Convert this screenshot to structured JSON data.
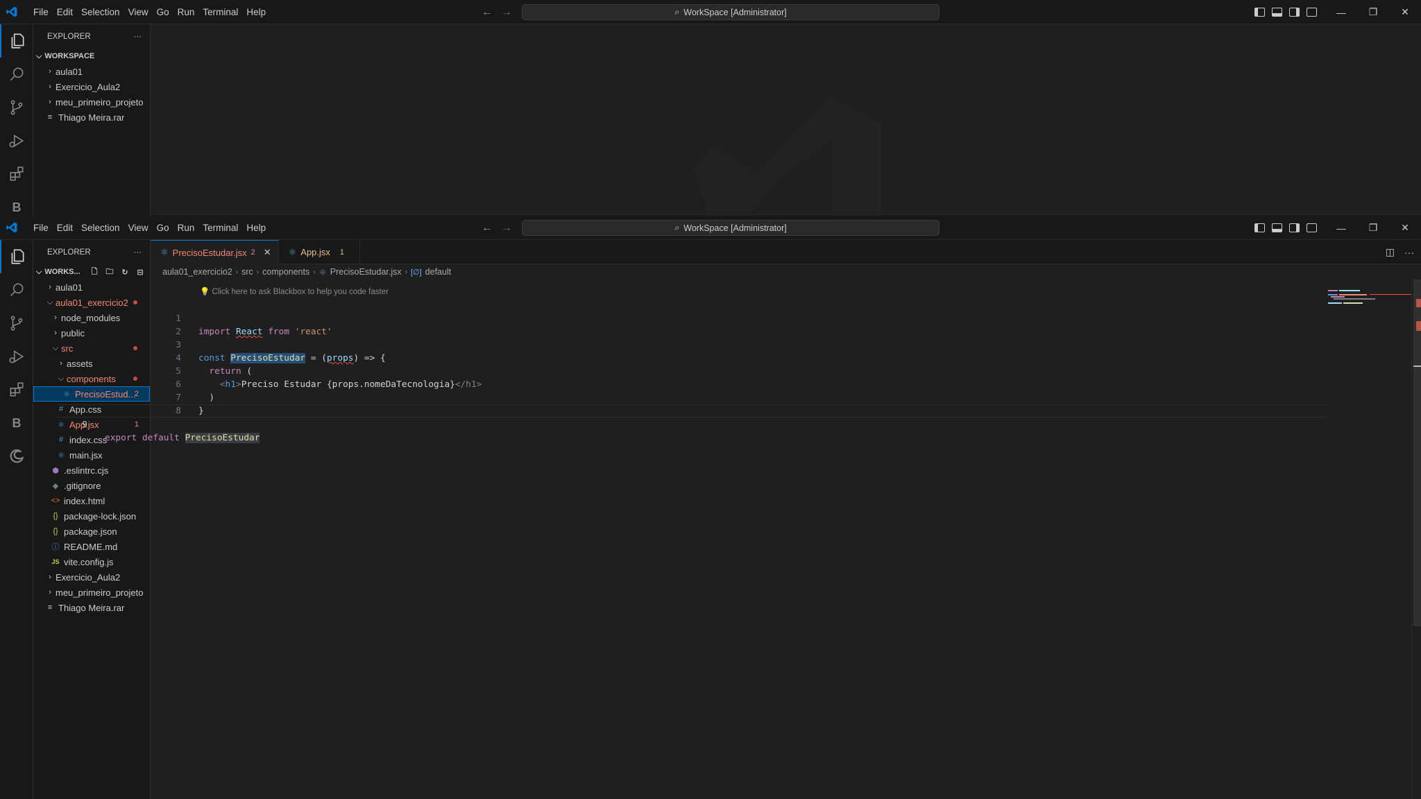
{
  "menu": [
    "File",
    "Edit",
    "Selection",
    "View",
    "Go",
    "Run",
    "Terminal",
    "Help"
  ],
  "command_center": "WorkSpace [Administrator]",
  "explorer_title": "EXPLORER",
  "bg_window": {
    "section": "WORKSPACE",
    "tree": [
      {
        "label": "aula01",
        "type": "folder"
      },
      {
        "label": "Exercicio_Aula2",
        "type": "folder"
      },
      {
        "label": "meu_primeiro_projeto",
        "type": "folder"
      },
      {
        "label": "Thiago Meira.rar",
        "type": "file"
      }
    ]
  },
  "front_window": {
    "section": "WORKS...",
    "tree": [
      {
        "label": "aula01",
        "depth": 0,
        "type": "folder",
        "open": false
      },
      {
        "label": "aula01_exercicio2",
        "depth": 0,
        "type": "folder",
        "open": true,
        "error": true,
        "dot": true
      },
      {
        "label": "node_modules",
        "depth": 1,
        "type": "folder",
        "open": false
      },
      {
        "label": "public",
        "depth": 1,
        "type": "folder",
        "open": false
      },
      {
        "label": "src",
        "depth": 1,
        "type": "folder",
        "open": true,
        "error": true,
        "dot": true
      },
      {
        "label": "assets",
        "depth": 2,
        "type": "folder",
        "open": false
      },
      {
        "label": "components",
        "depth": 2,
        "type": "folder",
        "open": true,
        "error": true,
        "dot": true
      },
      {
        "label": "PrecisoEstud...",
        "depth": 3,
        "type": "react",
        "error": true,
        "badge": "2",
        "selected": true
      },
      {
        "label": "App.css",
        "depth": 2,
        "type": "css"
      },
      {
        "label": "App.jsx",
        "depth": 2,
        "type": "react",
        "error": true,
        "badge": "1"
      },
      {
        "label": "index.css",
        "depth": 2,
        "type": "css"
      },
      {
        "label": "main.jsx",
        "depth": 2,
        "type": "react"
      },
      {
        "label": ".eslintrc.cjs",
        "depth": 1,
        "type": "eslint"
      },
      {
        "label": ".gitignore",
        "depth": 1,
        "type": "git"
      },
      {
        "label": "index.html",
        "depth": 1,
        "type": "html"
      },
      {
        "label": "package-lock.json",
        "depth": 1,
        "type": "json"
      },
      {
        "label": "package.json",
        "depth": 1,
        "type": "json"
      },
      {
        "label": "README.md",
        "depth": 1,
        "type": "info"
      },
      {
        "label": "vite.config.js",
        "depth": 1,
        "type": "js"
      },
      {
        "label": "Exercicio_Aula2",
        "depth": 0,
        "type": "folder",
        "open": false
      },
      {
        "label": "meu_primeiro_projeto",
        "depth": 0,
        "type": "folder",
        "open": false
      },
      {
        "label": "Thiago Meira.rar",
        "depth": 0,
        "type": "file"
      }
    ]
  },
  "tabs": [
    {
      "label": "PrecisoEstudar.jsx",
      "badge": "2",
      "active": true
    },
    {
      "label": "App.jsx",
      "badge": "1",
      "active": false
    }
  ],
  "breadcrumb": [
    "aula01_exercicio2",
    "src",
    "components",
    "PrecisoEstudar.jsx",
    "default"
  ],
  "hint": "Click here to ask Blackbox to help you code faster",
  "code_lines": [
    "1",
    "2",
    "3",
    "4",
    "5",
    "6",
    "7",
    "8",
    "9"
  ],
  "code": {
    "l1": {
      "import": "import",
      "react": "React",
      "from": "from",
      "str": "'react'"
    },
    "l3": {
      "const": "const",
      "name": "PrecisoEstudar",
      "eq": " = (",
      "props": "props",
      "arrow": ") => {"
    },
    "l4": {
      "ret": "return",
      "paren": " ("
    },
    "l5": {
      "open": "<",
      "tag": "h1",
      "close": ">",
      "text": "Preciso Estudar {props.nomeDaTecnologia}",
      "end": "</h1>"
    },
    "l6": ")",
    "l7": "}",
    "l9": {
      "export": "export",
      "default": "default",
      "name": "PrecisoEstudar"
    }
  },
  "icons": {
    "activity": [
      "files-icon",
      "search-icon",
      "source-control-icon",
      "run-debug-icon",
      "extensions-icon",
      "blackbox-icon",
      "edge-icon"
    ]
  }
}
